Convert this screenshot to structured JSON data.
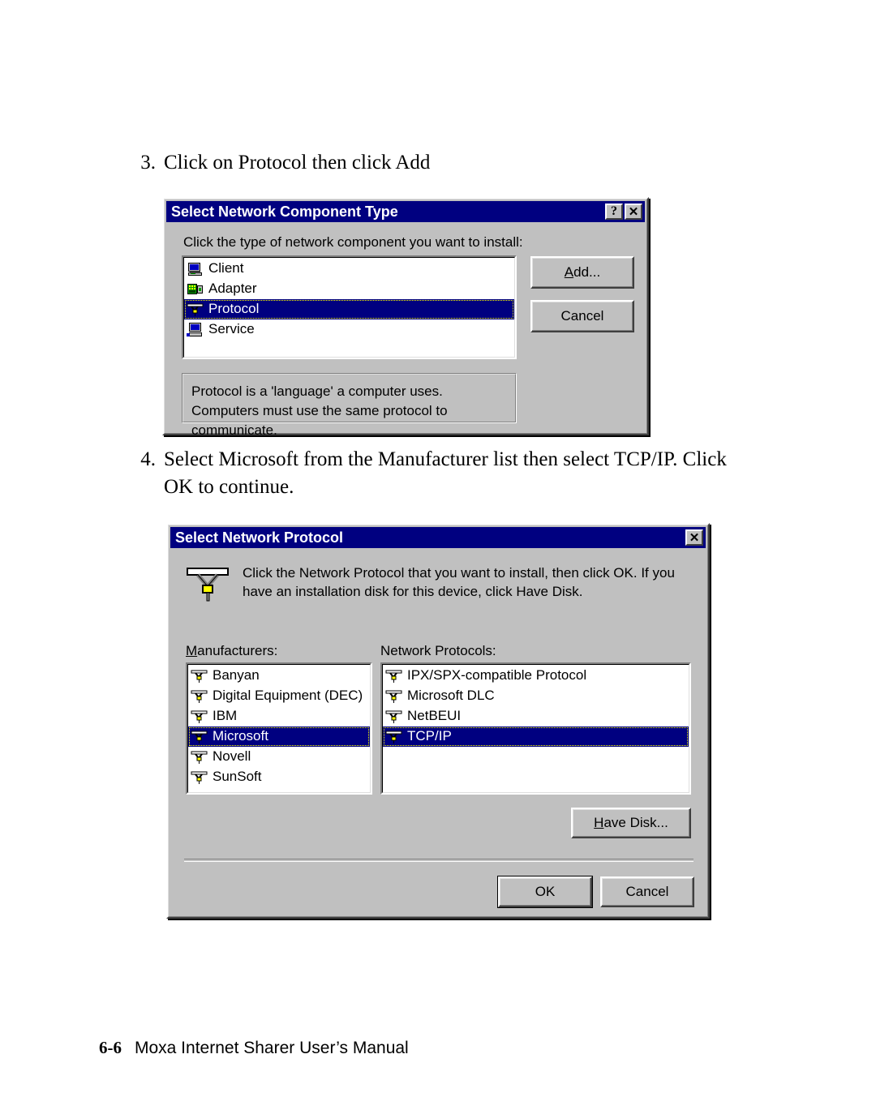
{
  "page": {
    "footer_page_number": "6-6",
    "footer_title": "Moxa Internet Sharer User’s Manual"
  },
  "steps": [
    {
      "number": "3.",
      "text": "Click on Protocol then click Add"
    },
    {
      "number": "4.",
      "text": "Select Microsoft from the Manufacturer list then select TCP/IP. Click OK to continue."
    }
  ],
  "dialog1": {
    "title": "Select Network Component Type",
    "titlebar_buttons": [
      {
        "name": "help-button",
        "glyph": "?"
      },
      {
        "name": "close-button",
        "glyph": "✕"
      }
    ],
    "prompt": "Click the type of network component you want to install:",
    "list_items": [
      {
        "label": "Client",
        "icon": "client-icon",
        "selected": false
      },
      {
        "label": "Adapter",
        "icon": "adapter-icon",
        "selected": false
      },
      {
        "label": "Protocol",
        "icon": "protocol-icon",
        "selected": true
      },
      {
        "label": "Service",
        "icon": "service-icon",
        "selected": false
      }
    ],
    "buttons": [
      {
        "label": "Add...",
        "accel": "A"
      },
      {
        "label": "Cancel",
        "accel": ""
      }
    ],
    "description": "Protocol is a 'language' a computer uses. Computers must use the same protocol to communicate."
  },
  "dialog2": {
    "title": "Select Network Protocol",
    "titlebar_buttons": [
      {
        "name": "close-button",
        "glyph": "✕"
      }
    ],
    "instruction": "Click the Network Protocol that you want to install, then click OK. If you have an installation disk for this device, click Have Disk.",
    "manufacturers_label": "Manufacturers:",
    "manufacturers_accel": "M",
    "protocols_label": "Network Protocols:",
    "manufacturers": [
      {
        "label": "Banyan",
        "selected": false
      },
      {
        "label": "Digital Equipment (DEC)",
        "selected": false
      },
      {
        "label": "IBM",
        "selected": false
      },
      {
        "label": "Microsoft",
        "selected": true
      },
      {
        "label": "Novell",
        "selected": false
      },
      {
        "label": "SunSoft",
        "selected": false
      }
    ],
    "protocols": [
      {
        "label": "IPX/SPX-compatible Protocol",
        "selected": false
      },
      {
        "label": "Microsoft DLC",
        "selected": false
      },
      {
        "label": "NetBEUI",
        "selected": false
      },
      {
        "label": "TCP/IP",
        "selected": true
      }
    ],
    "have_disk_button": "Have Disk...",
    "have_disk_accel": "H",
    "ok_button": "OK",
    "cancel_button": "Cancel"
  },
  "colors": {
    "titlebar": "#000080",
    "dialog_face": "#c0c0c0",
    "selection": "#000080",
    "selection_text": "#ffffff",
    "focus_outline": "#ffff00",
    "page_background": "#ffffff"
  }
}
